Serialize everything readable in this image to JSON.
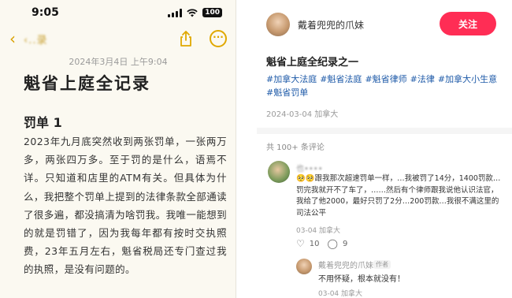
{
  "colors": {
    "accent": "#ff2d55",
    "tag": "#1e5aa8",
    "notes_yellow": "#e0a800",
    "background": "#fbf9f1"
  },
  "phone": {
    "status": {
      "time": "9:05",
      "battery": "100"
    },
    "nav": {
      "folder_name": "‹..录",
      "back_icon": "chevron-left-icon",
      "share_icon": "share-icon",
      "more_icon": "ellipsis-circle-icon"
    },
    "note": {
      "date": "2024年3月4日 上午9:04",
      "title": "魁省上庭全记录",
      "heading": "罚单 1",
      "body": "2023年九月底突然收到两张罚单，一张两万多，两张四万多。至于罚的是什么，语焉不详。只知道和店里的ATM有关。但具体为什么，我把整个罚单上提到的法律条款全部通读了很多遍，都没搞清为啥罚我。我唯一能想到的就是罚错了，因为我每年都有按时交执照费，23年五月左右，魁省税局还专门查过我的执照，是没有问题的。"
    }
  },
  "post": {
    "author": {
      "name": "戴着兜兜的爪妹"
    },
    "follow_label": "关注",
    "title": "魁省上庭全纪录之一",
    "tags": [
      "#加拿大法庭",
      "#魁省法庭",
      "#魁省律师",
      "#法律",
      "#加拿大小生意",
      "#魁省罚单"
    ],
    "date": "2024-03-04 加拿大",
    "comment_count": "共 100+ 条评论"
  },
  "comment": {
    "name": "也••••",
    "text": "🥺🥺跟我那次超速罚单一样，…我被罚了14分，1400罚款…罚完我就开不了车了，……然后有个律师跟我说他认识法官，我给了他2000，最好只罚了2分…200罚款…我很不满这里的司法公平",
    "meta": "03-04 加拿大",
    "likes": "10",
    "replies": "9"
  },
  "reply": {
    "name": "戴着兜兜的爪妹",
    "badge": "作者",
    "text": "不用怀疑，根本就没有！",
    "meta": "03-04 加拿大"
  }
}
